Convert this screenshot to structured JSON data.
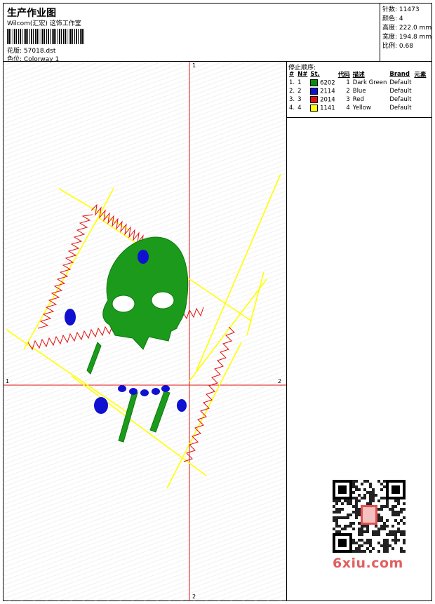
{
  "header": {
    "title": "生产作业图",
    "subtitle": "Wilcom(汇宏) 这饰工作室",
    "design_label": "花版:",
    "design_value": "57018.dst",
    "colorway_label": "色位:",
    "colorway_value": "Colorway 1"
  },
  "stats": {
    "stitches_label": "针数:",
    "stitches_value": "11473",
    "colors_label": "颜色:",
    "colors_value": "4",
    "height_label": "高度:",
    "height_value": "222.0 mm",
    "width_label": "宽度:",
    "width_value": "194.8 mm",
    "scale_label": "比例:",
    "scale_value": "0.68"
  },
  "sequence": {
    "title": "停止顺序:",
    "columns": [
      "#",
      "N#",
      "St.",
      "代码",
      "描述",
      "Brand",
      "元素"
    ],
    "rows": [
      {
        "num": "1.",
        "n": "1",
        "code": "6202",
        "idx": "1",
        "desc": "Dark Green",
        "brand": "Default",
        "color": "#0a8a0a"
      },
      {
        "num": "2.",
        "n": "2",
        "code": "2114",
        "idx": "2",
        "desc": "Blue",
        "brand": "Default",
        "color": "#1010d0"
      },
      {
        "num": "3.",
        "n": "3",
        "code": "2014",
        "idx": "3",
        "desc": "Red",
        "brand": "Default",
        "color": "#e01010"
      },
      {
        "num": "4.",
        "n": "4",
        "code": "1141",
        "idx": "4",
        "desc": "Yellow",
        "brand": "Default",
        "color": "#ffff00"
      }
    ]
  },
  "axes": {
    "top": "1",
    "left": "1",
    "right": "2",
    "bottom": "2"
  },
  "watermark": "6xiu.com"
}
